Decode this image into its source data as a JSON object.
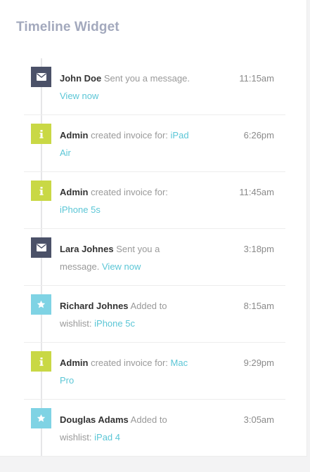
{
  "widget": {
    "title": "Timeline Widget"
  },
  "items": [
    {
      "type": "message",
      "icon": "envelope-icon",
      "name": "John Doe",
      "action": "Sent you a message.",
      "link": "View now",
      "time": "11:15am"
    },
    {
      "type": "info",
      "icon": "info-icon",
      "name": "Admin",
      "action": "created invoice for:",
      "link": "iPad Air",
      "time": "6:26pm"
    },
    {
      "type": "info",
      "icon": "info-icon",
      "name": "Admin",
      "action": "created invoice for:",
      "link": "iPhone 5s",
      "time": "11:45am"
    },
    {
      "type": "message",
      "icon": "envelope-icon",
      "name": "Lara Johnes",
      "action": "Sent you a message.",
      "link": "View now",
      "time": "3:18pm"
    },
    {
      "type": "star",
      "icon": "star-icon",
      "name": "Richard Johnes",
      "action": "Added to wishlist:",
      "link": "iPhone 5c",
      "time": "8:15am"
    },
    {
      "type": "info",
      "icon": "info-icon",
      "name": "Admin",
      "action": "created invoice for:",
      "link": "Mac Pro",
      "time": "9:29pm"
    },
    {
      "type": "star",
      "icon": "star-icon",
      "name": "Douglas Adams",
      "action": "Added to wishlist:",
      "link": "iPad 4",
      "time": "3:05am"
    }
  ],
  "colors": {
    "message": "#4b5168",
    "info": "#c9d845",
    "star": "#7fd3e4",
    "link": "#5bc6d6"
  }
}
